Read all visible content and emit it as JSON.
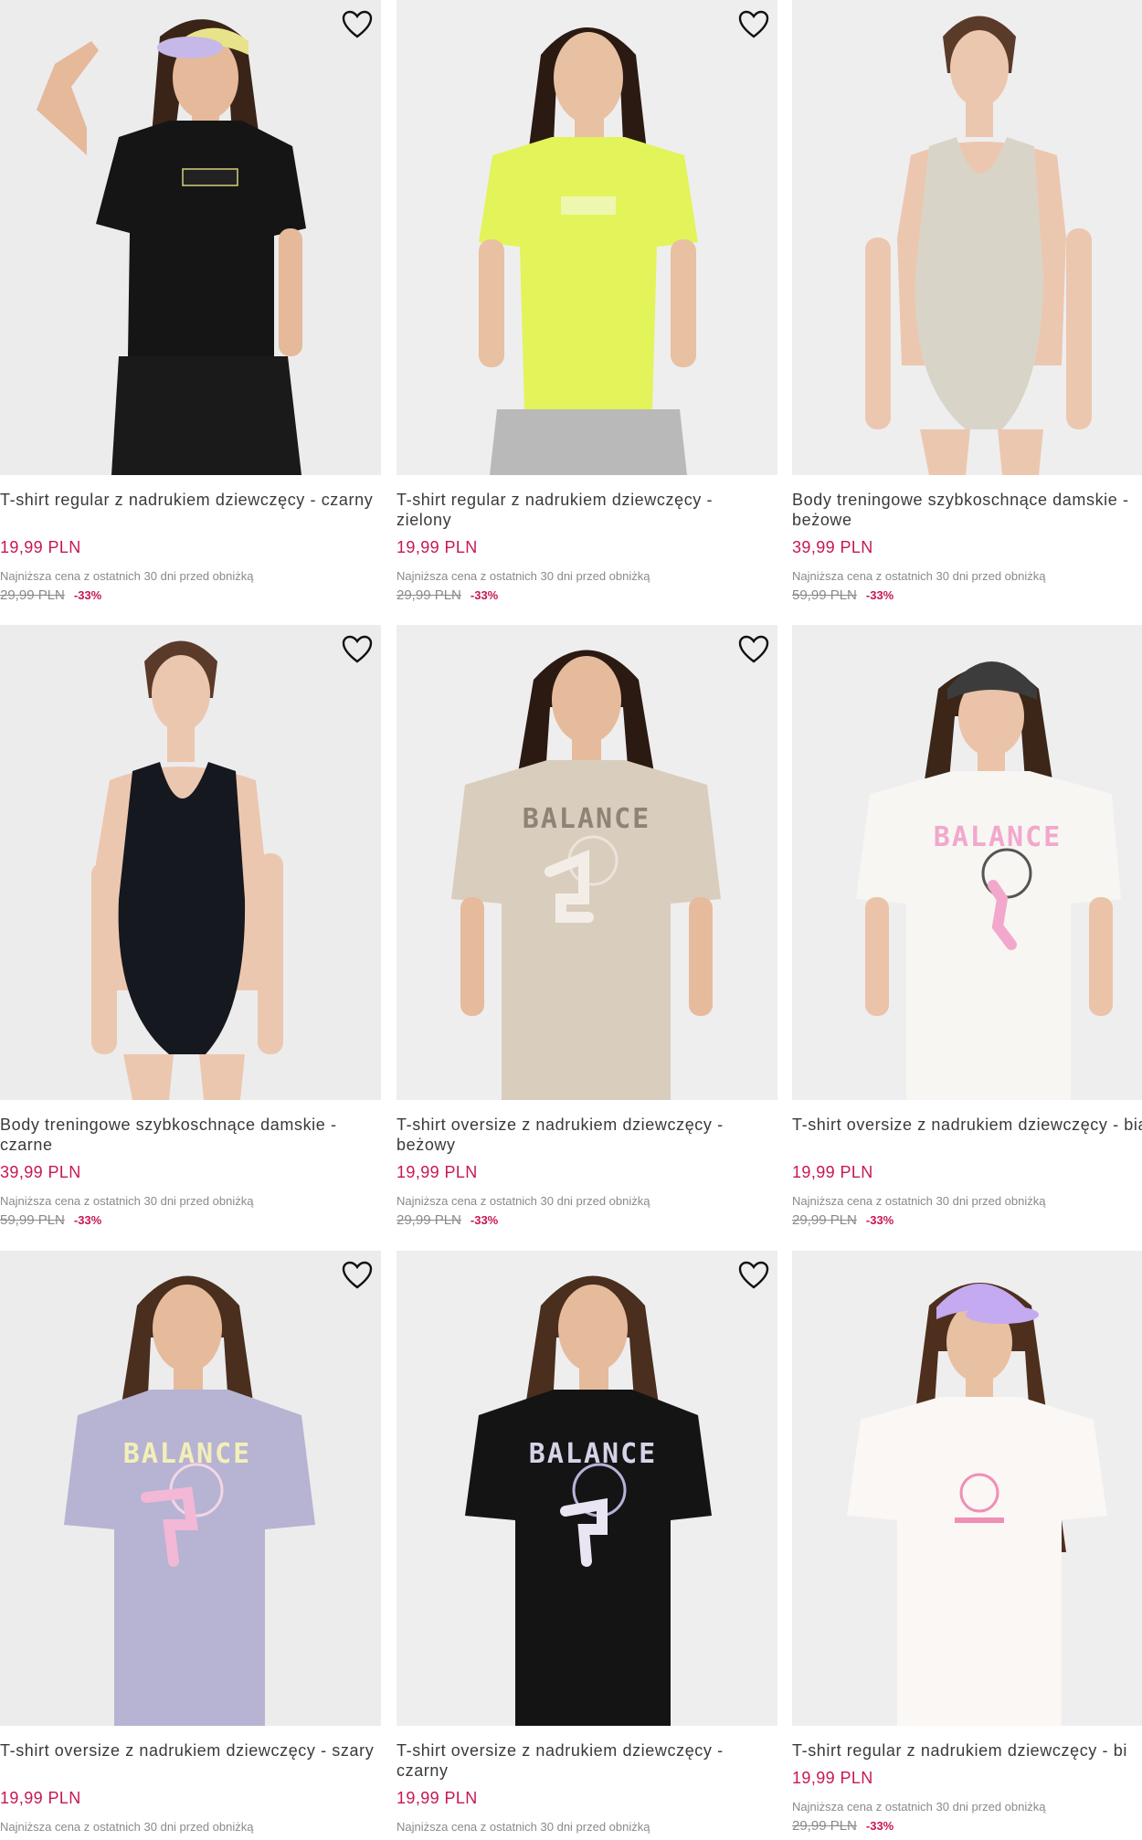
{
  "products": [
    {
      "title": "T-shirt regular z nadrukiem dziewczęcy - czarny",
      "price": "19,99 PLN",
      "lowest_note": "Najniższa cena z ostatnich 30 dni przed obniżką",
      "old_price": "29,99 PLN",
      "discount": "-33%",
      "colors": {
        "garment": "#151515",
        "bottom": "#1a1a1a",
        "skin": "#e5b99a",
        "hair": "#3a2418",
        "cap": "#e8e38a"
      },
      "icons": {
        "wishlist": "heart-outline-icon"
      }
    },
    {
      "title": "T-shirt regular z nadrukiem dziewczęcy - zielony",
      "price": "19,99 PLN",
      "lowest_note": "Najniższa cena z ostatnich 30 dni przed obniżką",
      "old_price": "29,99 PLN",
      "discount": "-33%",
      "colors": {
        "garment": "#e3f35a",
        "bottom": "#b9b9b9",
        "skin": "#e8c0a2",
        "hair": "#2a1a12"
      },
      "icons": {
        "wishlist": "heart-outline-icon"
      }
    },
    {
      "title": "Body treningowe szybkoschnące damskie - beżowe",
      "price": "39,99 PLN",
      "lowest_note": "Najniższa cena z ostatnich 30 dni przed obniżką",
      "old_price": "59,99 PLN",
      "discount": "-33%",
      "colors": {
        "garment": "#d9d4c8",
        "skin": "#ecc7b0",
        "hair": "#5a3a28"
      },
      "icons": {
        "wishlist": "heart-outline-icon"
      }
    },
    {
      "title": "Body treningowe szybkoschnące damskie - czarne",
      "price": "39,99 PLN",
      "lowest_note": "Najniższa cena z ostatnich 30 dni przed obniżką",
      "old_price": "59,99 PLN",
      "discount": "-33%",
      "colors": {
        "garment": "#16181f",
        "skin": "#ecc7b0",
        "hair": "#5a3a28"
      },
      "icons": {
        "wishlist": "heart-outline-icon"
      }
    },
    {
      "title": "T-shirt oversize z nadrukiem dziewczęcy - beżowy",
      "price": "19,99 PLN",
      "lowest_note": "Najniższa cena z ostatnich 30 dni przed obniżką",
      "old_price": "29,99 PLN",
      "discount": "-33%",
      "print": "BALANCE",
      "colors": {
        "garment": "#d9cdbd",
        "print": "#8f8378",
        "skin": "#e5bb9c",
        "hair": "#2b1a12"
      },
      "icons": {
        "wishlist": "heart-outline-icon"
      }
    },
    {
      "title": "T-shirt oversize z nadrukiem dziewczęcy - biały",
      "price": "19,99 PLN",
      "lowest_note": "Najniższa cena z ostatnich 30 dni przed obniżką",
      "old_price": "29,99 PLN",
      "discount": "-33%",
      "print": "BALANCE",
      "colors": {
        "garment": "#f7f6f3",
        "print": "#f2a8cc",
        "skin": "#eac3a8",
        "hair": "#3b2618",
        "cap": "#3c3c3c"
      },
      "icons": {
        "wishlist": "heart-outline-icon"
      }
    },
    {
      "title": "T-shirt oversize z nadrukiem dziewczęcy - szary",
      "price": "19,99 PLN",
      "lowest_note": "Najniższa cena z ostatnich 30 dni przed obniżką",
      "print": "BALANCE",
      "colors": {
        "garment": "#b7b3d2",
        "print": "#f3efb8",
        "skin": "#e5bb9c",
        "hair": "#4a2e1e"
      },
      "icons": {
        "wishlist": "heart-outline-icon"
      }
    },
    {
      "title": "T-shirt oversize z nadrukiem dziewczęcy - czarny",
      "price": "19,99 PLN",
      "lowest_note": "Najniższa cena z ostatnich 30 dni przed obniżką",
      "print": "BALANCE",
      "colors": {
        "garment": "#141414",
        "print": "#d7d2e8",
        "skin": "#e5bb9c",
        "hair": "#4a2e1e"
      },
      "icons": {
        "wishlist": "heart-outline-icon"
      }
    },
    {
      "title": "T-shirt regular z nadrukiem dziewczęcy - bi",
      "price": "19,99 PLN",
      "lowest_note": "Najniższa cena z ostatnich 30 dni przed obniżką",
      "old_price": "29,99 PLN",
      "discount": "-33%",
      "colors": {
        "garment": "#fbf7f4",
        "print": "#ef8fb6",
        "skin": "#e8c0a2",
        "hair": "#4e2f1e",
        "cap": "#c4aaf0"
      },
      "icons": {
        "wishlist": "heart-outline-icon"
      }
    }
  ]
}
